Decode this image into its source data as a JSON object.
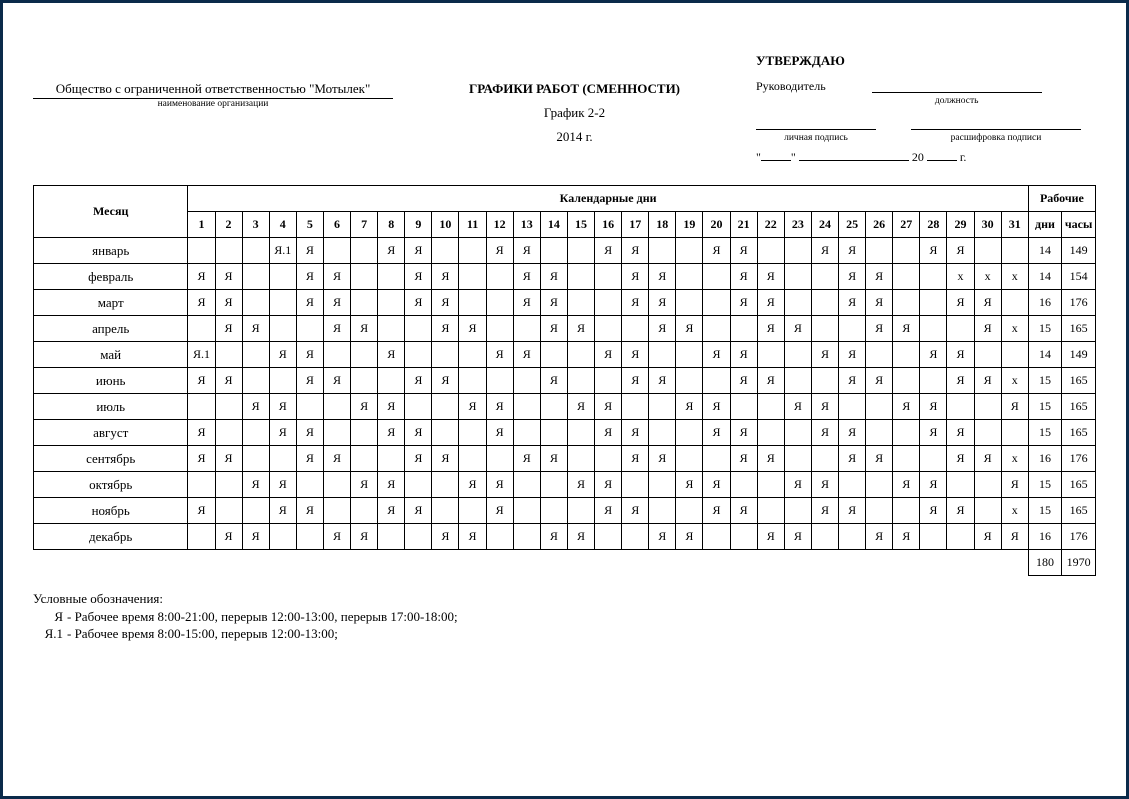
{
  "header": {
    "org_name": "Общество с ограниченной ответственностью \"Мотылек\"",
    "org_caption": "наименование организации",
    "title": "ГРАФИКИ РАБОТ (СМЕННОСТИ)",
    "subtitle": "График 2-2",
    "year": "2014 г.",
    "approve_title": "УТВЕРЖДАЮ",
    "approve_role": "Руководитель",
    "position_caption": "должность",
    "signature_caption": "личная подпись",
    "decipher_caption": "расшифровка подписи",
    "date_20": "20",
    "date_g": "г."
  },
  "table": {
    "month_header": "Месяц",
    "days_header": "Календарные дни",
    "work_header": "Рабочие",
    "days_sum_header": "дни",
    "hours_sum_header": "часы",
    "day_numbers": [
      "1",
      "2",
      "3",
      "4",
      "5",
      "6",
      "7",
      "8",
      "9",
      "10",
      "11",
      "12",
      "13",
      "14",
      "15",
      "16",
      "17",
      "18",
      "19",
      "20",
      "21",
      "22",
      "23",
      "24",
      "25",
      "26",
      "27",
      "28",
      "29",
      "30",
      "31"
    ],
    "months": [
      {
        "name": "январь",
        "cells": [
          "",
          "",
          "",
          "Я.1",
          "Я",
          "",
          "",
          "Я",
          "Я",
          "",
          "",
          "Я",
          "Я",
          "",
          "",
          "Я",
          "Я",
          "",
          "",
          "Я",
          "Я",
          "",
          "",
          "Я",
          "Я",
          "",
          "",
          "Я",
          "Я",
          "",
          ""
        ],
        "days": "14",
        "hours": "149"
      },
      {
        "name": "февраль",
        "cells": [
          "Я",
          "Я",
          "",
          "",
          "Я",
          "Я",
          "",
          "",
          "Я",
          "Я",
          "",
          "",
          "Я",
          "Я",
          "",
          "",
          "Я",
          "Я",
          "",
          "",
          "Я",
          "Я",
          "",
          "",
          "Я",
          "Я",
          "",
          "",
          "x",
          "x",
          "x"
        ],
        "days": "14",
        "hours": "154"
      },
      {
        "name": "март",
        "cells": [
          "Я",
          "Я",
          "",
          "",
          "Я",
          "Я",
          "",
          "",
          "Я",
          "Я",
          "",
          "",
          "Я",
          "Я",
          "",
          "",
          "Я",
          "Я",
          "",
          "",
          "Я",
          "Я",
          "",
          "",
          "Я",
          "Я",
          "",
          "",
          "Я",
          "Я",
          ""
        ],
        "days": "16",
        "hours": "176"
      },
      {
        "name": "апрель",
        "cells": [
          "",
          "Я",
          "Я",
          "",
          "",
          "Я",
          "Я",
          "",
          "",
          "Я",
          "Я",
          "",
          "",
          "Я",
          "Я",
          "",
          "",
          "Я",
          "Я",
          "",
          "",
          "Я",
          "Я",
          "",
          "",
          "Я",
          "Я",
          "",
          "",
          "Я",
          "x"
        ],
        "days": "15",
        "hours": "165"
      },
      {
        "name": "май",
        "cells": [
          "Я.1",
          "",
          "",
          "Я",
          "Я",
          "",
          "",
          "Я",
          "",
          "",
          "",
          "Я",
          "Я",
          "",
          "",
          "Я",
          "Я",
          "",
          "",
          "Я",
          "Я",
          "",
          "",
          "Я",
          "Я",
          "",
          "",
          "Я",
          "Я",
          "",
          ""
        ],
        "days": "14",
        "hours": "149"
      },
      {
        "name": "июнь",
        "cells": [
          "Я",
          "Я",
          "",
          "",
          "Я",
          "Я",
          "",
          "",
          "Я",
          "Я",
          "",
          "",
          "",
          "Я",
          "",
          "",
          "Я",
          "Я",
          "",
          "",
          "Я",
          "Я",
          "",
          "",
          "Я",
          "Я",
          "",
          "",
          "Я",
          "Я",
          "x"
        ],
        "days": "15",
        "hours": "165"
      },
      {
        "name": "июль",
        "cells": [
          "",
          "",
          "Я",
          "Я",
          "",
          "",
          "Я",
          "Я",
          "",
          "",
          "Я",
          "Я",
          "",
          "",
          "Я",
          "Я",
          "",
          "",
          "Я",
          "Я",
          "",
          "",
          "Я",
          "Я",
          "",
          "",
          "Я",
          "Я",
          "",
          "",
          "Я"
        ],
        "days": "15",
        "hours": "165"
      },
      {
        "name": "август",
        "cells": [
          "Я",
          "",
          "",
          "Я",
          "Я",
          "",
          "",
          "Я",
          "Я",
          "",
          "",
          "Я",
          "",
          "",
          "",
          "Я",
          "Я",
          "",
          "",
          "Я",
          "Я",
          "",
          "",
          "Я",
          "Я",
          "",
          "",
          "Я",
          "Я",
          "",
          ""
        ],
        "days": "15",
        "hours": "165"
      },
      {
        "name": "сентябрь",
        "cells": [
          "Я",
          "Я",
          "",
          "",
          "Я",
          "Я",
          "",
          "",
          "Я",
          "Я",
          "",
          "",
          "Я",
          "Я",
          "",
          "",
          "Я",
          "Я",
          "",
          "",
          "Я",
          "Я",
          "",
          "",
          "Я",
          "Я",
          "",
          "",
          "Я",
          "Я",
          "x"
        ],
        "days": "16",
        "hours": "176"
      },
      {
        "name": "октябрь",
        "cells": [
          "",
          "",
          "Я",
          "Я",
          "",
          "",
          "Я",
          "Я",
          "",
          "",
          "Я",
          "Я",
          "",
          "",
          "Я",
          "Я",
          "",
          "",
          "Я",
          "Я",
          "",
          "",
          "Я",
          "Я",
          "",
          "",
          "Я",
          "Я",
          "",
          "",
          "Я"
        ],
        "days": "15",
        "hours": "165"
      },
      {
        "name": "ноябрь",
        "cells": [
          "Я",
          "",
          "",
          "Я",
          "Я",
          "",
          "",
          "Я",
          "Я",
          "",
          "",
          "Я",
          "",
          "",
          "",
          "Я",
          "Я",
          "",
          "",
          "Я",
          "Я",
          "",
          "",
          "Я",
          "Я",
          "",
          "",
          "Я",
          "Я",
          "",
          "x"
        ],
        "days": "15",
        "hours": "165"
      },
      {
        "name": "декабрь",
        "cells": [
          "",
          "Я",
          "Я",
          "",
          "",
          "Я",
          "Я",
          "",
          "",
          "Я",
          "Я",
          "",
          "",
          "Я",
          "Я",
          "",
          "",
          "Я",
          "Я",
          "",
          "",
          "Я",
          "Я",
          "",
          "",
          "Я",
          "Я",
          "",
          "",
          "Я",
          "Я"
        ],
        "days": "16",
        "hours": "176"
      }
    ],
    "total_days": "180",
    "total_hours": "1970"
  },
  "legend": {
    "title": "Условные обозначения:",
    "items": [
      {
        "code": "Я",
        "text": "Рабочее время 8:00-21:00, перерыв 12:00-13:00, перерыв 17:00-18:00;"
      },
      {
        "code": "Я.1",
        "text": "Рабочее время 8:00-15:00, перерыв 12:00-13:00;"
      }
    ]
  }
}
